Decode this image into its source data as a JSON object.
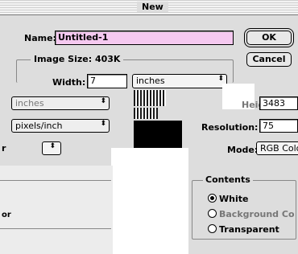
{
  "window": {
    "title": "New"
  },
  "name_row": {
    "label": "Name:",
    "value": "Untitled-1"
  },
  "buttons": {
    "ok": "OK",
    "cancel": "Cancel"
  },
  "image_size": {
    "label": "Image Size:",
    "value": "403K"
  },
  "width": {
    "label": "Width:",
    "value": "7",
    "unit": "inches"
  },
  "height": {
    "label": "Height:",
    "value": "3483"
  },
  "left_selects": {
    "unit_1": "inches",
    "unit_2": "pixels/inch"
  },
  "resolution": {
    "label": "Resolution:",
    "value": "75"
  },
  "mode": {
    "label": "Mode:",
    "value": "RGB Color"
  },
  "contents": {
    "label": "Contents",
    "options": [
      {
        "label": "White",
        "selected": true
      },
      {
        "label": "Background Color",
        "selected": false
      },
      {
        "label": "Transparent",
        "selected": false
      }
    ]
  },
  "fragments": {
    "left_r": "r",
    "left_or": "or"
  }
}
